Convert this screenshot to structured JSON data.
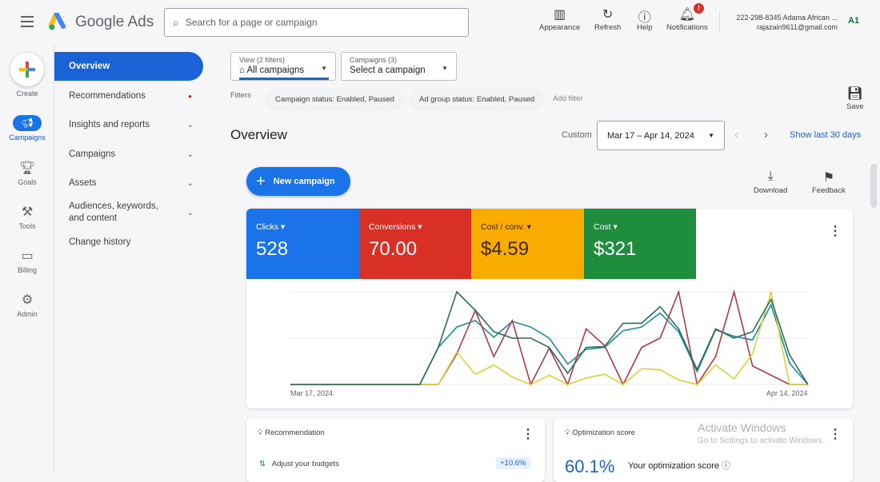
{
  "header": {
    "product": "Google Ads",
    "search_placeholder": "Search for a page or campaign",
    "actions": [
      {
        "label": "Appearance",
        "icon": "appearance-icon"
      },
      {
        "label": "Refresh",
        "icon": "refresh-icon"
      },
      {
        "label": "Help",
        "icon": "help-icon"
      },
      {
        "label": "Notifications",
        "icon": "bell-icon",
        "badge": "!"
      }
    ],
    "account_line1": "222-298-8345 Adama African ...",
    "account_line2": "rajazain9611@gmail.com",
    "avatar": "A1"
  },
  "rail": [
    {
      "label": "Create"
    },
    {
      "label": "Campaigns"
    },
    {
      "label": "Goals"
    },
    {
      "label": "Tools"
    },
    {
      "label": "Billing"
    },
    {
      "label": "Admin"
    }
  ],
  "nav": [
    {
      "label": "Overview"
    },
    {
      "label": "Recommendations"
    },
    {
      "label": "Insights and reports"
    },
    {
      "label": "Campaigns"
    },
    {
      "label": "Assets"
    },
    {
      "label": "Audiences, keywords, and content"
    },
    {
      "label": "Change history"
    }
  ],
  "view": {
    "label": "View (2 filters)",
    "value": "All campaigns"
  },
  "campaigns": {
    "label": "Campaigns (3)",
    "value": "Select a campaign"
  },
  "filters": {
    "label": "Filters",
    "chips": [
      "Campaign status: Enabled, Paused",
      "Ad group status: Enabled, Paused"
    ],
    "add": "Add filter"
  },
  "save": "Save",
  "page_title": "Overview",
  "date": {
    "prefix": "Custom",
    "range": "Mar 17 – Apr 14, 2024",
    "show_last": "Show last 30 days"
  },
  "new_campaign": "New campaign",
  "download": "Download",
  "feedback": "Feedback",
  "metrics": [
    {
      "label": "Clicks",
      "value": "528",
      "color": "#1a73e8"
    },
    {
      "label": "Conversions",
      "value": "70.00",
      "color": "#d93025"
    },
    {
      "label": "Cost / conv.",
      "value": "$4.59",
      "color": "#f9ab00"
    },
    {
      "label": "Cost",
      "value": "$321",
      "color": "#1e8e3e"
    }
  ],
  "chart_data": {
    "type": "line",
    "x_start": "Mar 17, 2024",
    "x_end": "Apr 14, 2024",
    "points": 29,
    "y_normalized": true,
    "series": [
      {
        "name": "Clicks",
        "color": "#1a8fa0",
        "values": [
          0,
          0,
          0,
          0,
          0,
          0,
          0,
          0,
          0.4,
          0.62,
          0.69,
          0.51,
          0.68,
          0.62,
          0.5,
          0.22,
          0.38,
          0.4,
          0.58,
          0.62,
          0.77,
          0.57,
          0.14,
          0.59,
          0.52,
          0.48,
          0.86,
          0.23,
          0
        ]
      },
      {
        "name": "Conversions",
        "color": "#b0394a",
        "values": [
          0,
          0,
          0,
          0,
          0,
          0,
          0,
          0,
          0,
          0.33,
          0.8,
          0.3,
          0.69,
          0,
          0.39,
          0,
          0.6,
          0.42,
          0,
          0.4,
          0.5,
          1.0,
          0,
          0.3,
          1.0,
          0.2,
          0.1,
          0,
          0
        ]
      },
      {
        "name": "Cost / conv.",
        "color": "#d8d23a",
        "values": [
          0,
          0,
          0,
          0,
          0,
          0,
          0,
          0,
          0,
          0.35,
          0.11,
          0.21,
          0.08,
          0,
          0.1,
          0,
          0.07,
          0.11,
          0,
          0.17,
          0.16,
          0.05,
          0,
          0.21,
          0.06,
          0.33,
          1.0,
          0,
          0
        ]
      },
      {
        "name": "Cost",
        "color": "#2a6e5a",
        "values": [
          0,
          0,
          0,
          0,
          0,
          0,
          0,
          0,
          0.4,
          1.0,
          0.8,
          0.57,
          0.5,
          0.5,
          0.4,
          0.12,
          0.4,
          0.41,
          0.66,
          0.66,
          0.84,
          0.6,
          0.16,
          0.6,
          0.5,
          0.57,
          0.92,
          0.32,
          0
        ]
      }
    ]
  },
  "recommendation": {
    "title": "Recommendation",
    "item": "Adjust your budgets",
    "delta": "+10.6%"
  },
  "optimization": {
    "title": "Optimization score",
    "score": "60.1%",
    "subtitle": "Your optimization score"
  },
  "watermark": {
    "line1": "Activate Windows",
    "line2": "Go to Settings to activate Windows."
  }
}
